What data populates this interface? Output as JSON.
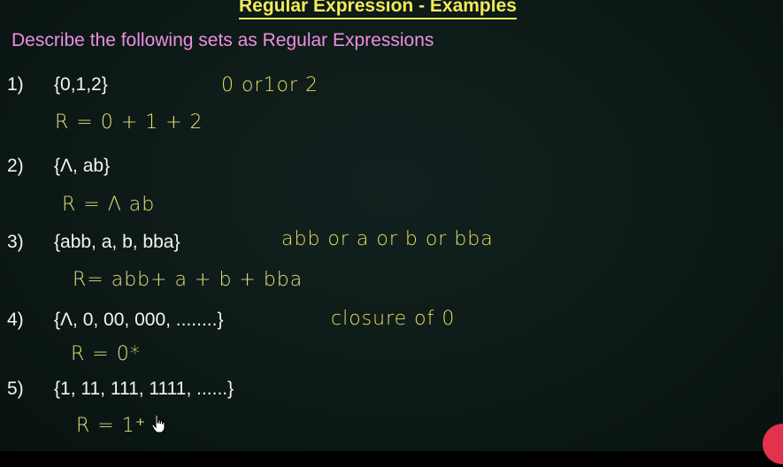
{
  "title": "Regular Expression - Examples",
  "instruction": "Describe the following sets as Regular Expressions",
  "items": [
    {
      "number": "1)",
      "set": "{0,1,2}",
      "note": "0 or1or 2",
      "regex": "R = 0 + 1 + 2"
    },
    {
      "number": "2)",
      "set": "{Λ, ab}",
      "note": "",
      "regex": "R = Λ ab"
    },
    {
      "number": "3)",
      "set": "{abb, a, b, bba}",
      "note": "abb or a or b or bba",
      "regex": "R= abb+ a + b + bba"
    },
    {
      "number": "4)",
      "set": "{Λ, 0, 00, 000, ........}",
      "note": "closure of 0",
      "regex": "R = 0*"
    },
    {
      "number": "5)",
      "set": "{1, 11, 111, 1111, ......}",
      "note": "",
      "regex": "R = 1⁺"
    }
  ],
  "icons": {
    "cursor": "hand-pointer-icon"
  },
  "colors": {
    "background": "#0c1917",
    "title": "#f3ea57",
    "instruction": "#ec8fe0",
    "set_text": "#f4f4f4",
    "handwriting": "#e4e07a"
  }
}
